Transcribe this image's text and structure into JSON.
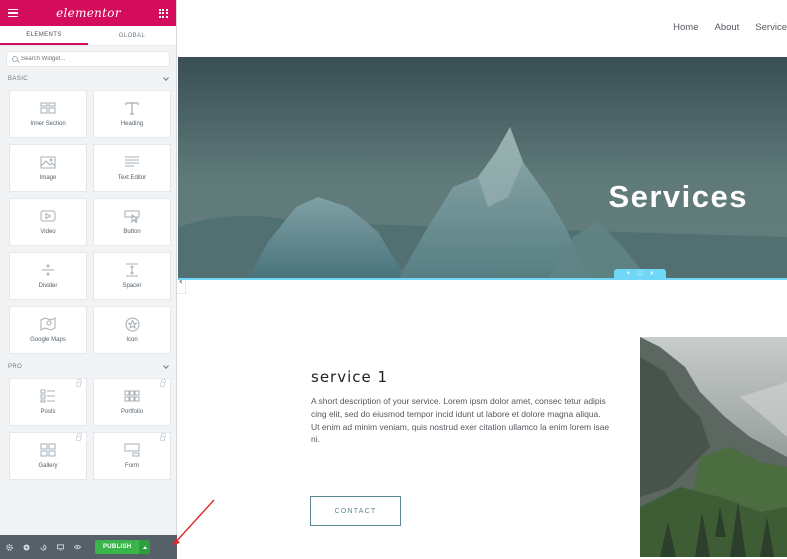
{
  "editor": {
    "logo": "elementor",
    "tabs": [
      {
        "label": "ELEMENTS",
        "active": true
      },
      {
        "label": "GLOBAL",
        "active": false
      }
    ],
    "search": {
      "placeholder": "Search Widget..."
    },
    "categories": {
      "basic": "BASIC",
      "pro": "PRO"
    },
    "basic_widgets": [
      {
        "label": "Inner Section",
        "icon": "columns-icon"
      },
      {
        "label": "Heading",
        "icon": "heading-icon"
      },
      {
        "label": "Image",
        "icon": "image-icon"
      },
      {
        "label": "Text Editor",
        "icon": "text-editor-icon"
      },
      {
        "label": "Video",
        "icon": "video-icon"
      },
      {
        "label": "Button",
        "icon": "button-icon"
      },
      {
        "label": "Divider",
        "icon": "divider-icon"
      },
      {
        "label": "Spacer",
        "icon": "spacer-icon"
      },
      {
        "label": "Google Maps",
        "icon": "map-icon"
      },
      {
        "label": "Icon",
        "icon": "star-icon"
      }
    ],
    "pro_widgets": [
      {
        "label": "Posts",
        "icon": "posts-icon",
        "locked": true
      },
      {
        "label": "Portfolio",
        "icon": "portfolio-icon",
        "locked": true
      },
      {
        "label": "Gallery",
        "icon": "gallery-icon",
        "locked": true
      },
      {
        "label": "Form",
        "icon": "form-icon",
        "locked": true
      }
    ],
    "footer": {
      "publish_label": "PUBLISH",
      "icons": [
        "settings-icon",
        "navigator-icon",
        "history-icon",
        "responsive-icon",
        "preview-icon"
      ]
    },
    "colors": {
      "brand": "#d30c5c",
      "publish": "#39b54a",
      "section_handle": "#71d7f7"
    }
  },
  "page": {
    "nav": [
      "Home",
      "About",
      "Service"
    ],
    "hero_title": "Services",
    "service": {
      "title": "service 1",
      "description": "A short description of your service. Lorem ipsm dolor amet, consec tetur adipis cing elit, sed do eiusmod tempor incid idunt ut labore et dolore magna aliqua. Ut enim ad minim veniam, quis nostrud exer citation ullamco la enim lorem isae ni.",
      "button": "CONTACT"
    }
  }
}
